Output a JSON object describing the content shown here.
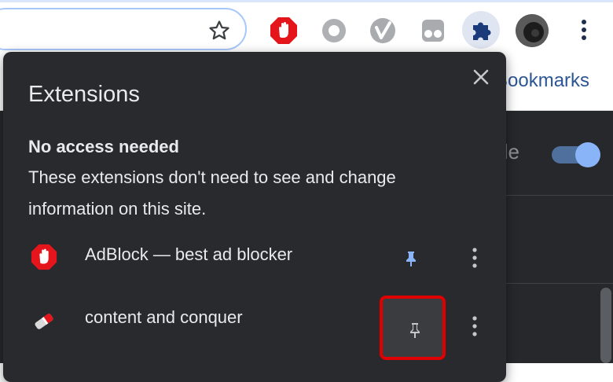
{
  "browser": {
    "bookmarks_label": "Bookmarks"
  },
  "page": {
    "partial_text": "de",
    "toggle_on": true
  },
  "extensions_popup": {
    "title": "Extensions",
    "section_heading": "No access needed",
    "section_description": "These extensions don't need to see and change information on this site.",
    "items": [
      {
        "name": "AdBlock — best ad blocker",
        "icon": "adblock-hand-icon",
        "pinned": true
      },
      {
        "name": "content and conquer",
        "icon": "eraser-icon",
        "pinned": false
      }
    ]
  },
  "colors": {
    "popup_bg": "#292a2d",
    "accent_blue": "#8ab4f8",
    "highlight_red": "#e00000",
    "adblock_red": "#e4151b"
  }
}
